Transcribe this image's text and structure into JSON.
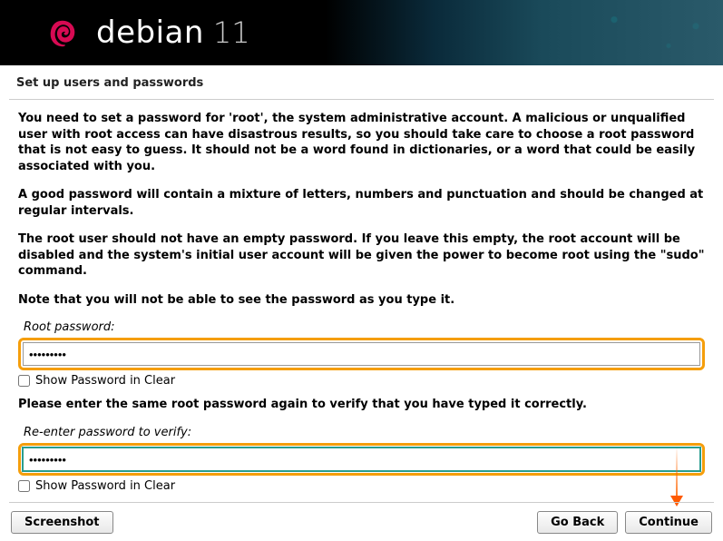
{
  "brand": {
    "name": "debian",
    "version": "11"
  },
  "step_title": "Set up users and passwords",
  "paragraphs": {
    "p1": "You need to set a password for 'root', the system administrative account. A malicious or unqualified user with root access can have disastrous results, so you should take care to choose a root password that is not easy to guess. It should not be a word found in dictionaries, or a word that could be easily associated with you.",
    "p2": "A good password will contain a mixture of letters, numbers and punctuation and should be changed at regular intervals.",
    "p3": "The root user should not have an empty password. If you leave this empty, the root account will be disabled and the system's initial user account will be given the power to become root using the \"sudo\" command.",
    "p4": "Note that you will not be able to see the password as you type it."
  },
  "fields": {
    "root_password": {
      "label": "Root password:",
      "value": "•••••••••",
      "show_label": "Show Password in Clear"
    },
    "verify_prompt": "Please enter the same root password again to verify that you have typed it correctly.",
    "verify_password": {
      "label": "Re-enter password to verify:",
      "value": "•••••••••",
      "show_label": "Show Password in Clear"
    }
  },
  "buttons": {
    "screenshot": "Screenshot",
    "go_back": "Go Back",
    "continue": "Continue"
  }
}
